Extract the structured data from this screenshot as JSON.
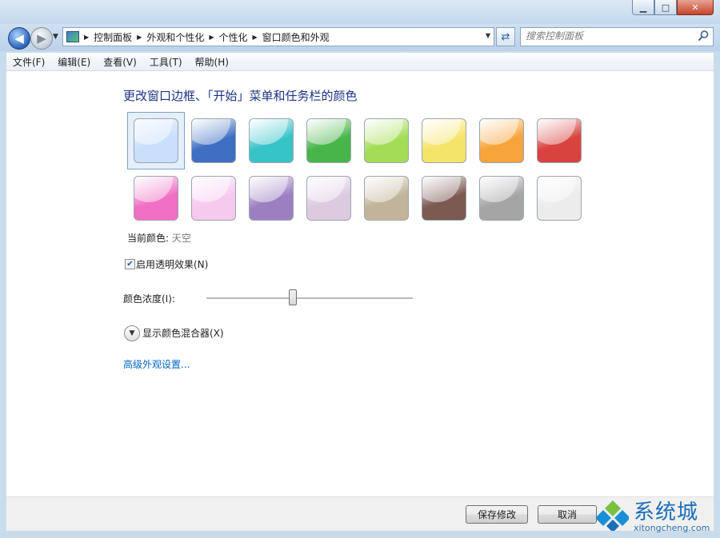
{
  "window": {
    "caption_buttons": {
      "minimize": "▁",
      "maximize": "□",
      "close": "✕"
    }
  },
  "nav": {
    "back_icon": "back-arrow-icon",
    "forward_icon": "forward-arrow-icon",
    "breadcrumbs": [
      "控制面板",
      "外观和个性化",
      "个性化",
      "窗口颜色和外观"
    ],
    "search_placeholder": "搜索控制面板"
  },
  "menu": [
    {
      "label": "文件(F)"
    },
    {
      "label": "编辑(E)"
    },
    {
      "label": "查看(V)"
    },
    {
      "label": "工具(T)"
    },
    {
      "label": "帮助(H)"
    }
  ],
  "main": {
    "heading": "更改窗口边框、「开始」菜单和任务栏的颜色",
    "swatches": [
      {
        "name": "sky",
        "color": "#c8e0fa",
        "selected": true
      },
      {
        "name": "twilight",
        "color": "#3f6fc2"
      },
      {
        "name": "sea",
        "color": "#37c4c8"
      },
      {
        "name": "leaf",
        "color": "#48b54a"
      },
      {
        "name": "lime",
        "color": "#a4dd55"
      },
      {
        "name": "lemon",
        "color": "#f4e56a"
      },
      {
        "name": "pumpkin",
        "color": "#f7a43a"
      },
      {
        "name": "ruby",
        "color": "#d8423f"
      },
      {
        "name": "fuchsia",
        "color": "#f070c5"
      },
      {
        "name": "blush",
        "color": "#f6c9ef"
      },
      {
        "name": "violet",
        "color": "#9c7fc1"
      },
      {
        "name": "lavender",
        "color": "#dccbe0"
      },
      {
        "name": "taupe",
        "color": "#c2b49a"
      },
      {
        "name": "chocolate",
        "color": "#7b5a52"
      },
      {
        "name": "slate",
        "color": "#a5a5a5"
      },
      {
        "name": "frost",
        "color": "#ececec"
      }
    ],
    "current_color_label": "当前颜色:",
    "current_color_value": "天空",
    "transparency_label": "启用透明效果(N)",
    "transparency_checked": true,
    "intensity_label": "颜色浓度(I):",
    "intensity_value": 0.42,
    "mixer_label": "显示颜色混合器(X)",
    "advanced_link": "高级外观设置..."
  },
  "footer": {
    "save_label": "保存修改",
    "cancel_label": "取消"
  },
  "watermark": {
    "title": "系统城",
    "subtitle": "xitongcheng.com"
  }
}
